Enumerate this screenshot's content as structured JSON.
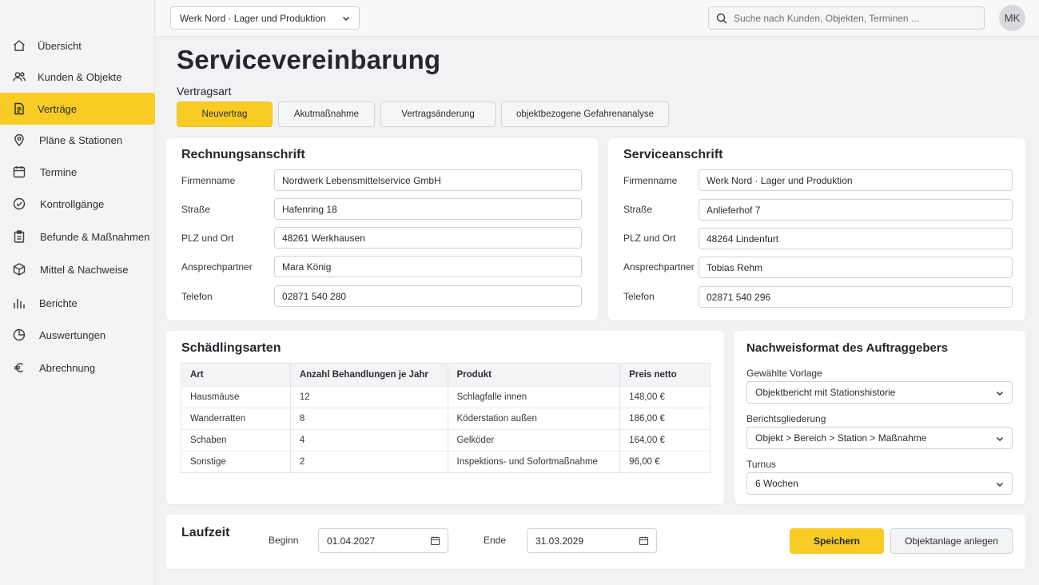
{
  "colors": {
    "accent": "#f8cb25",
    "background": "#f1f2f4",
    "card": "#ffffff"
  },
  "sidebar": {
    "items": [
      {
        "label": "Übersicht",
        "icon": "home-icon"
      },
      {
        "label": "Kunden & Objekte",
        "icon": "users-icon"
      },
      {
        "label": "Verträge",
        "icon": "document-icon",
        "active": true
      },
      {
        "label": "Pläne & Stationen",
        "icon": "map-pin-icon"
      },
      {
        "label": "Termine",
        "icon": "calendar-icon"
      },
      {
        "label": "Kontrollgänge",
        "icon": "check-circle-icon"
      },
      {
        "label": "Befunde & Maßnahmen",
        "icon": "clipboard-icon"
      },
      {
        "label": "Mittel & Nachweise",
        "icon": "box-icon"
      },
      {
        "label": "Berichte",
        "icon": "bar-chart-icon"
      },
      {
        "label": "Auswertungen",
        "icon": "pie-chart-icon"
      },
      {
        "label": "Abrechnung",
        "icon": "euro-icon"
      }
    ]
  },
  "topbar": {
    "location": "Werk Nord · Lager und Produktion",
    "search_placeholder": "Suche nach Kunden, Objekten, Terminen ...",
    "avatar_initials": "MK"
  },
  "page": {
    "title": "Servicevereinbarung",
    "contract_type_label": "Vertragsart",
    "contract_types": [
      {
        "label": "Neuvertrag",
        "active": true
      },
      {
        "label": "Akutmaßnahme"
      },
      {
        "label": "Vertragsänderung"
      },
      {
        "label": "objektbezogene Gefahrenanalyse"
      }
    ]
  },
  "billing": {
    "title": "Rechnungsanschrift",
    "fields": [
      {
        "label": "Firmenname",
        "value": "Nordwerk Lebensmittelservice GmbH"
      },
      {
        "label": "Straße",
        "value": "Hafenring 18"
      },
      {
        "label": "PLZ und Ort",
        "value": "48261 Werkhausen"
      },
      {
        "label": "Ansprechpartner",
        "value": "Mara König"
      },
      {
        "label": "Telefon",
        "value": "02871 540 280"
      }
    ]
  },
  "service": {
    "title": "Serviceanschrift",
    "fields": [
      {
        "label": "Firmenname",
        "value": "Werk Nord · Lager und Produktion"
      },
      {
        "label": "Straße",
        "value": "Anlieferhof 7"
      },
      {
        "label": "PLZ und Ort",
        "value": "48264 Lindenfurt"
      },
      {
        "label": "Ansprechpartner",
        "value": "Tobias Rehm"
      },
      {
        "label": "Telefon",
        "value": "02871 540 296"
      }
    ]
  },
  "pests": {
    "title": "Schädlingsarten",
    "columns": [
      "Art",
      "Anzahl Behandlungen je Jahr",
      "Produkt",
      "Preis netto"
    ],
    "rows": [
      [
        "Hausmäuse",
        "12",
        "Schlagfalle innen",
        "148,00 €"
      ],
      [
        "Wanderratten",
        "8",
        "Köderstation außen",
        "186,00 €"
      ],
      [
        "Schaben",
        "4",
        "Gelköder",
        "164,00 €"
      ],
      [
        "Sonstige",
        "2",
        "Inspektions- und Sofortmaßnahme",
        "96,00 €"
      ]
    ]
  },
  "report_format": {
    "title": "Nachweisformat des Auftraggebers",
    "template_label": "Gewählte Vorlage",
    "template_value": "Objektbericht mit Stationshistorie",
    "structure_label": "Berichtsgliederung",
    "structure_value": "Objekt > Bereich > Station > Maßnahme",
    "interval_label": "Turnus",
    "interval_value": "6 Wochen"
  },
  "term": {
    "title": "Laufzeit",
    "start_label": "Beginn",
    "start_value": "01.04.2027",
    "end_label": "Ende",
    "end_value": "31.03.2029",
    "save_label": "Speichern",
    "create_object_label": "Objektanlage anlegen"
  }
}
